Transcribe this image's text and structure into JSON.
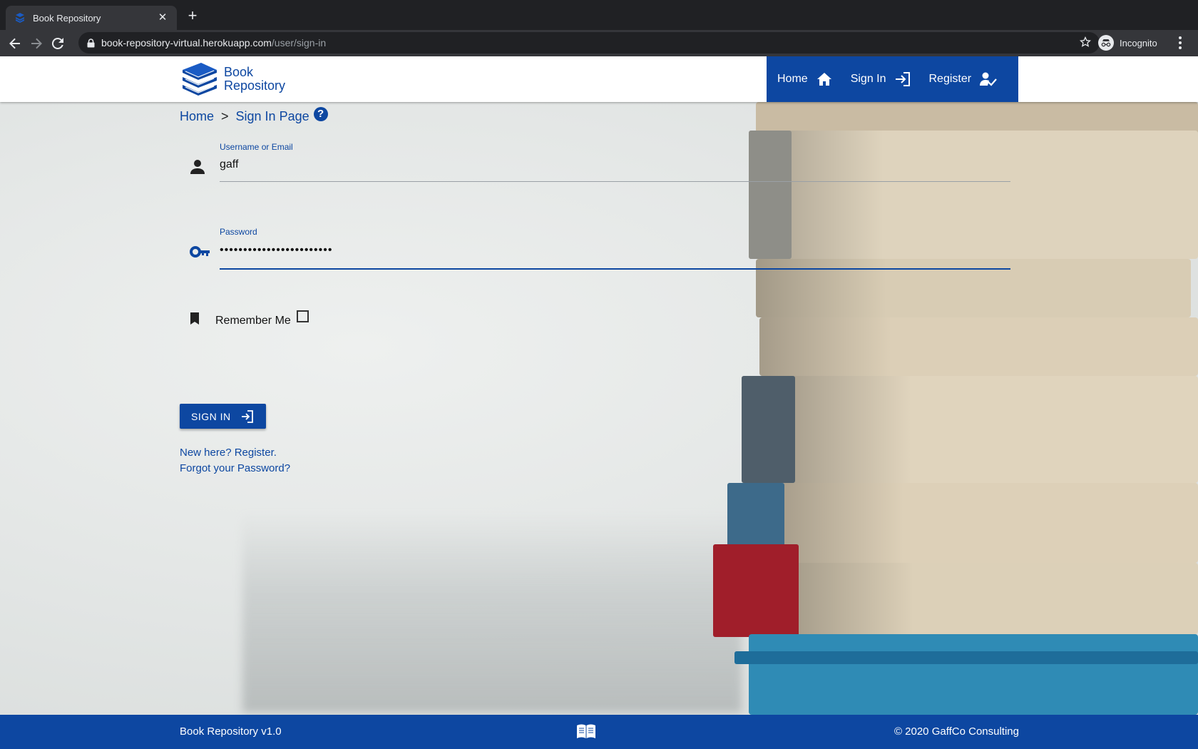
{
  "browser": {
    "tab_title": "Book Repository",
    "url_host": "book-repository-virtual.herokuapp.com",
    "url_path": "/user/sign-in",
    "profile_label": "Incognito"
  },
  "header": {
    "logo_line1": "Book",
    "logo_line2": "Repository",
    "nav": {
      "home": "Home",
      "sign_in": "Sign In",
      "register": "Register"
    }
  },
  "breadcrumb": {
    "home": "Home",
    "separator": ">",
    "current": "Sign In Page",
    "help": "?"
  },
  "form": {
    "username": {
      "label": "Username or Email",
      "value": "gaff"
    },
    "password": {
      "label": "Password",
      "value": "••••••••••••••••••••••••"
    },
    "remember_label": "Remember Me",
    "remember_checked": false,
    "submit_label": "SIGN IN",
    "register_link": "New here? Register.",
    "forgot_link": "Forgot your Password?"
  },
  "footer": {
    "version": "Book Repository v1.0",
    "copyright": "© 2020 GaffCo Consulting"
  },
  "colors": {
    "primary": "#0d47a1",
    "browser_dark": "#202124",
    "browser_toolbar": "#35363a"
  }
}
